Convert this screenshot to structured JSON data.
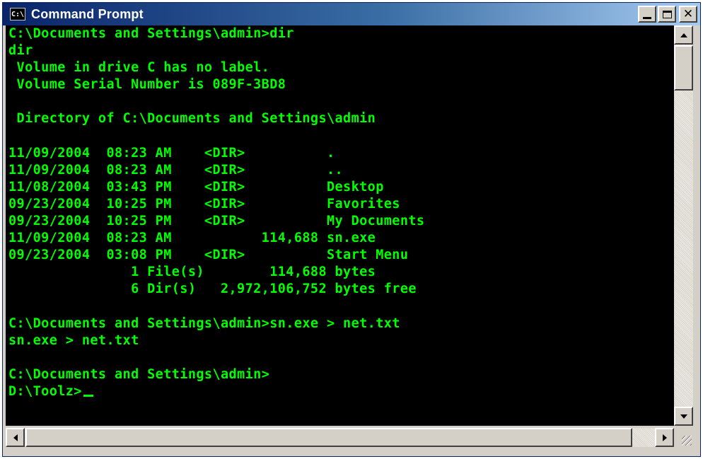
{
  "window": {
    "title": "Command Prompt",
    "icon_label": "C:\\"
  },
  "title_controls": {
    "minimize_icon": "minimize-icon",
    "maximize_icon": "maximize-icon",
    "close_icon": "close-icon"
  },
  "console": {
    "text_color": "#00ff00",
    "background": "#000000",
    "lines": [
      "C:\\Documents and Settings\\admin>dir",
      "dir",
      " Volume in drive C has no label.",
      " Volume Serial Number is 089F-3BD8",
      "",
      " Directory of C:\\Documents and Settings\\admin",
      "",
      "11/09/2004  08:23 AM    <DIR>          .",
      "11/09/2004  08:23 AM    <DIR>          ..",
      "11/08/2004  03:43 PM    <DIR>          Desktop",
      "09/23/2004  10:25 PM    <DIR>          Favorites",
      "09/23/2004  10:25 PM    <DIR>          My Documents",
      "11/09/2004  08:23 AM           114,688 sn.exe",
      "09/23/2004  03:08 PM    <DIR>          Start Menu",
      "               1 File(s)        114,688 bytes",
      "               6 Dir(s)   2,972,106,752 bytes free",
      "",
      "C:\\Documents and Settings\\admin>sn.exe > net.txt",
      "sn.exe > net.txt",
      "",
      "C:\\Documents and Settings\\admin>",
      "D:\\Toolz>"
    ]
  },
  "scrollbars": {
    "up_icon": "arrow-up-icon",
    "down_icon": "arrow-down-icon",
    "left_icon": "arrow-left-icon",
    "right_icon": "arrow-right-icon"
  }
}
